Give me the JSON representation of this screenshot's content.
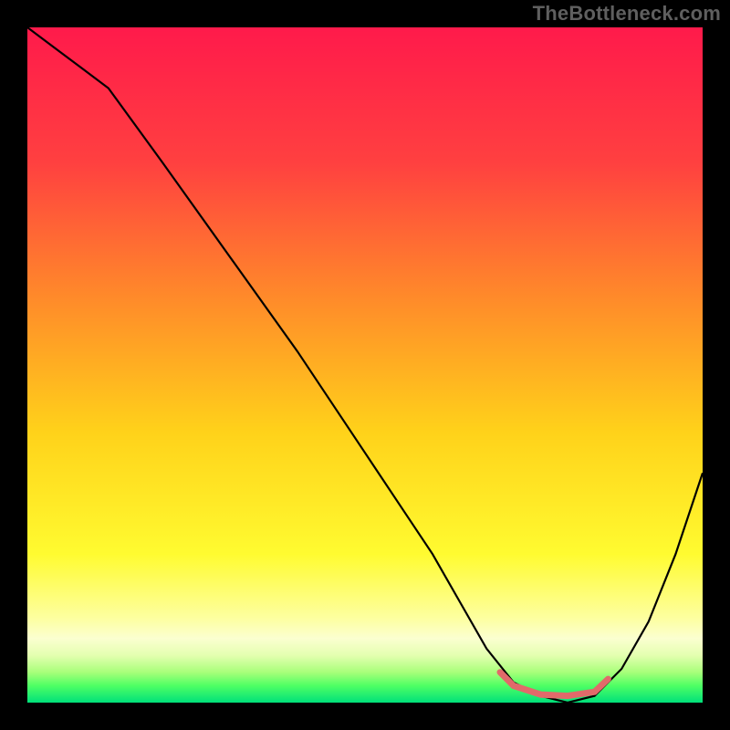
{
  "attribution": "TheBottleneck.com",
  "chart_data": {
    "type": "line",
    "title": "",
    "xlabel": "",
    "ylabel": "",
    "xlim": [
      0,
      100
    ],
    "ylim": [
      0,
      100
    ],
    "background_gradient_stops": [
      {
        "offset": 0.0,
        "color": "#ff1a4b"
      },
      {
        "offset": 0.2,
        "color": "#ff4040"
      },
      {
        "offset": 0.4,
        "color": "#ff8a2a"
      },
      {
        "offset": 0.6,
        "color": "#ffd21a"
      },
      {
        "offset": 0.78,
        "color": "#fffb30"
      },
      {
        "offset": 0.875,
        "color": "#fdffa0"
      },
      {
        "offset": 0.905,
        "color": "#fbffd0"
      },
      {
        "offset": 0.93,
        "color": "#e4ffb0"
      },
      {
        "offset": 0.955,
        "color": "#a8ff7a"
      },
      {
        "offset": 0.975,
        "color": "#4eff64"
      },
      {
        "offset": 1.0,
        "color": "#00e07a"
      }
    ],
    "series": [
      {
        "name": "bottleneck-curve",
        "stroke": "#000000",
        "stroke_width": 2.2,
        "x": [
          0,
          4,
          8,
          12,
          20,
          30,
          40,
          50,
          56,
          60,
          64,
          68,
          72,
          76,
          80,
          84,
          88,
          92,
          96,
          100
        ],
        "y": [
          100,
          97,
          94,
          91,
          80,
          66,
          52,
          37,
          28,
          22,
          15,
          8,
          3,
          1,
          0,
          1,
          5,
          12,
          22,
          34
        ]
      },
      {
        "name": "optimal-band",
        "stroke": "#e16a6a",
        "stroke_width": 7,
        "linecap": "round",
        "x": [
          70,
          72,
          76,
          80,
          84,
          86
        ],
        "y": [
          4.5,
          2.5,
          1.2,
          1.0,
          1.6,
          3.5
        ]
      }
    ]
  }
}
